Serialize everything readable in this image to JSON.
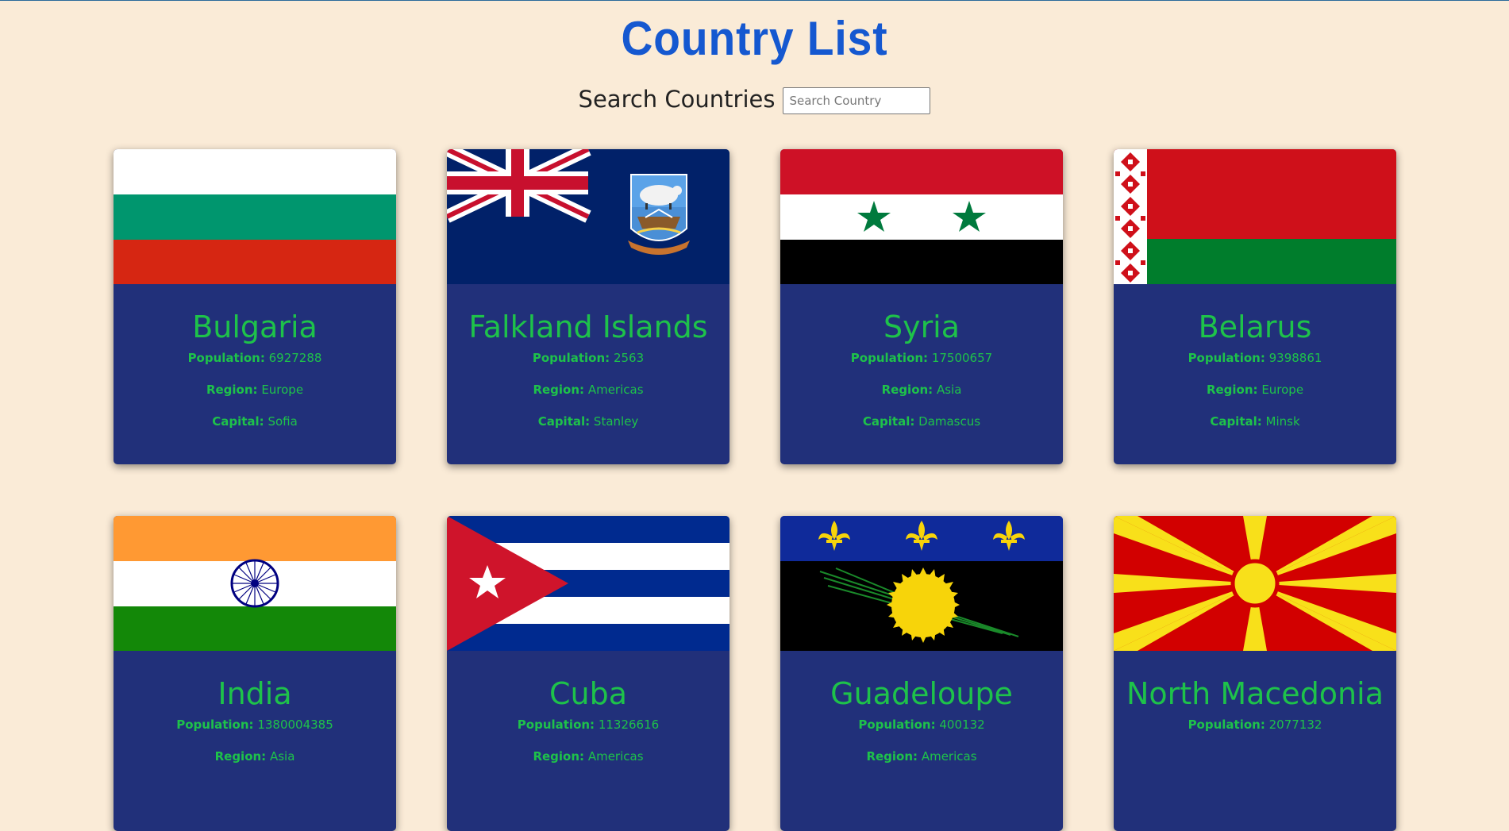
{
  "header": {
    "title": "Country List"
  },
  "search": {
    "label": "Search Countries",
    "placeholder": "Search Country",
    "value": ""
  },
  "labels": {
    "population": "Population:",
    "region": "Region:",
    "capital": "Capital:"
  },
  "countries": [
    {
      "name": "Bulgaria",
      "population": "6927288",
      "region": "Europe",
      "capital": "Sofia"
    },
    {
      "name": "Falkland Islands",
      "population": "2563",
      "region": "Americas",
      "capital": "Stanley"
    },
    {
      "name": "Syria",
      "population": "17500657",
      "region": "Asia",
      "capital": "Damascus"
    },
    {
      "name": "Belarus",
      "population": "9398861",
      "region": "Europe",
      "capital": "Minsk"
    },
    {
      "name": "India",
      "population": "1380004385",
      "region": "Asia",
      "capital": ""
    },
    {
      "name": "Cuba",
      "population": "11326616",
      "region": "Americas",
      "capital": ""
    },
    {
      "name": "Guadeloupe",
      "population": "400132",
      "region": "Americas",
      "capital": ""
    },
    {
      "name": "North Macedonia",
      "population": "2077132",
      "region": "",
      "capital": ""
    }
  ],
  "colors": {
    "background": "#FAEBD7",
    "title": "#1558d0",
    "card": "#21307a",
    "card_text": "#1ec24a"
  }
}
